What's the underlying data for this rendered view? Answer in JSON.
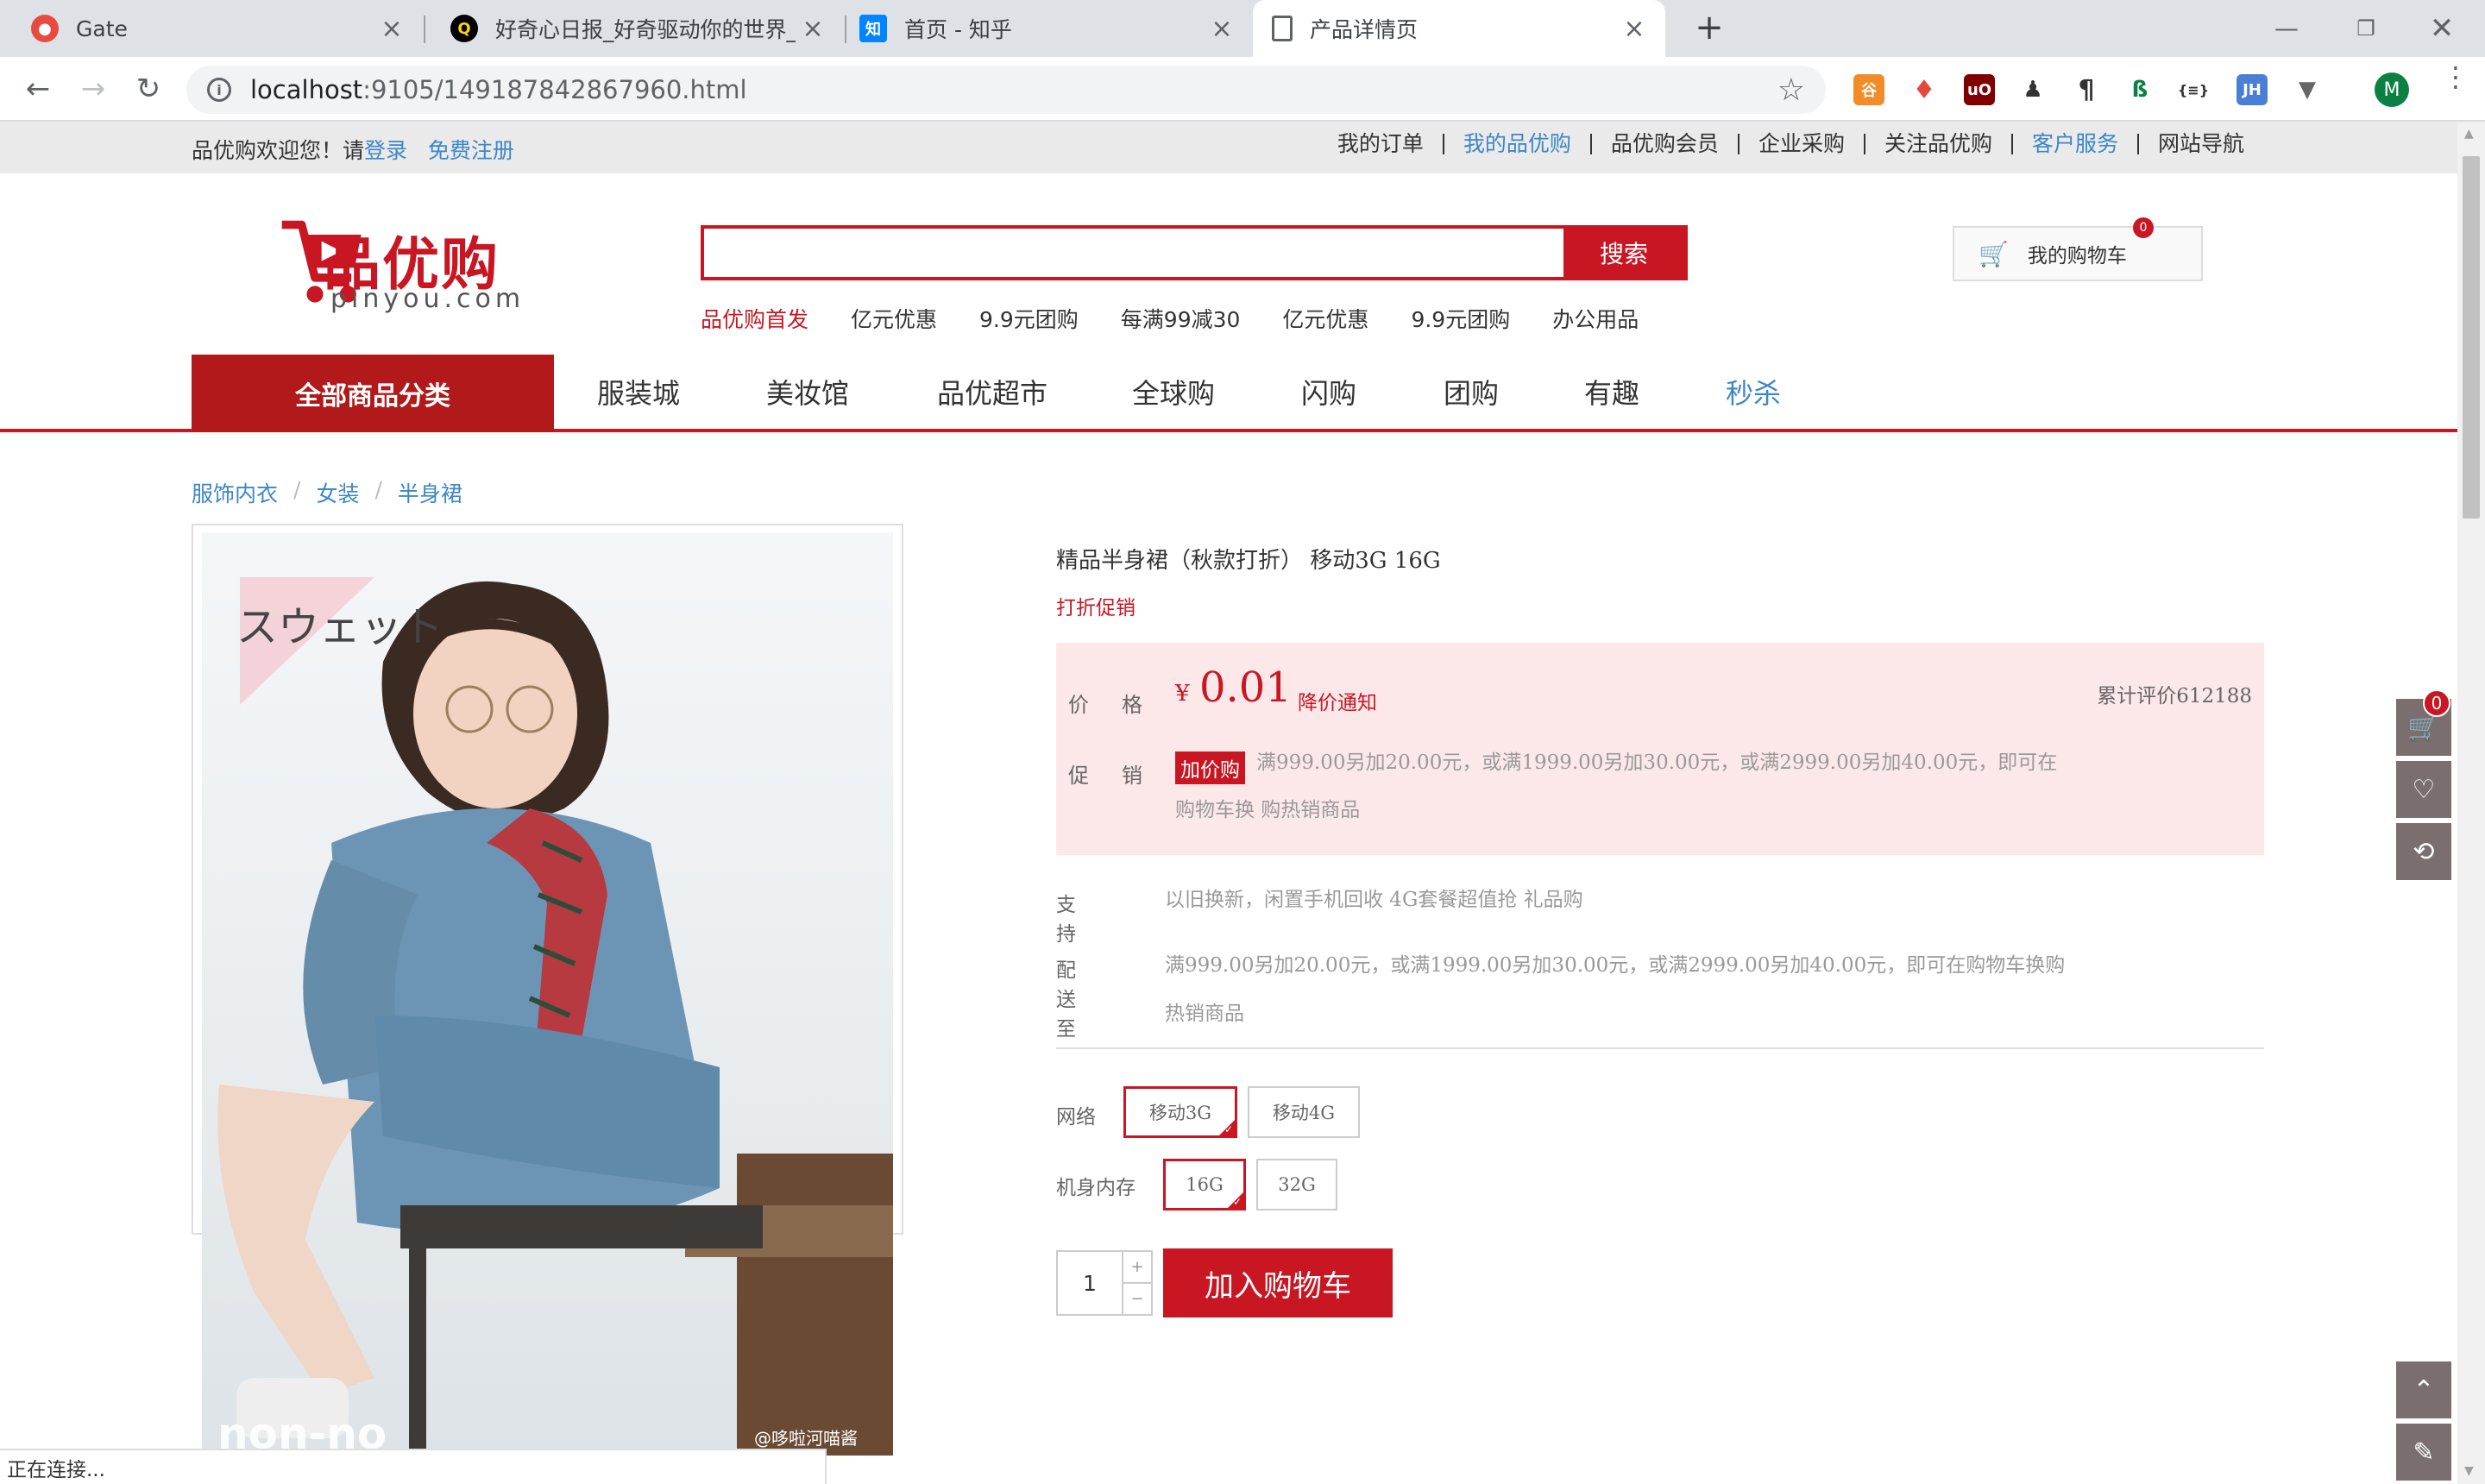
{
  "browser": {
    "tabs": [
      {
        "title": "Gate",
        "icon": "gate-favicon",
        "color": "#e94a3f"
      },
      {
        "title": "好奇心日报_好奇驱动你的世界_C",
        "icon": "qdaily-favicon",
        "color": "#000000"
      },
      {
        "title": "首页 - 知乎",
        "icon": "zhihu-favicon",
        "color": "#0084ff"
      },
      {
        "title": "产品详情页",
        "icon": "document-favicon",
        "color": "#5f6368"
      }
    ],
    "url_host": "localhost",
    "url_rest": ":9105/149187842867960.html",
    "avatar_letter": "M",
    "status_text": "正在连接..."
  },
  "site": {
    "welcome": "品优购欢迎您！请",
    "login": "登录",
    "register": "免费注册",
    "top_links": [
      {
        "label": "我的订单",
        "blue": false
      },
      {
        "label": "我的品优购",
        "blue": true
      },
      {
        "label": "品优购会员",
        "blue": false
      },
      {
        "label": "企业采购",
        "blue": false
      },
      {
        "label": "关注品优购",
        "blue": false
      },
      {
        "label": "客户服务",
        "blue": true
      },
      {
        "label": "网站导航",
        "blue": false
      }
    ],
    "logo_text": "品优购",
    "logo_sub": "pinyou.com",
    "search_button": "搜索",
    "search_placeholder": "",
    "hot_words": [
      "品优购首发",
      "亿元优惠",
      "9.9元团购",
      "每满99减30",
      "亿元优惠",
      "9.9元团购",
      "办公用品"
    ],
    "cart_label": "我的购物车",
    "cart_count": "0",
    "all_categories": "全部商品分类",
    "nav": [
      {
        "label": "服装城",
        "blue": false
      },
      {
        "label": "美妆馆",
        "blue": false
      },
      {
        "label": "品优超市",
        "blue": false
      },
      {
        "label": "全球购",
        "blue": false
      },
      {
        "label": "闪购",
        "blue": false
      },
      {
        "label": "团购",
        "blue": false
      },
      {
        "label": "有趣",
        "blue": false
      },
      {
        "label": "秒杀",
        "blue": true
      }
    ],
    "accent_color": "#c81623",
    "link_color": "#3c87c7"
  },
  "product": {
    "breadcrumb": [
      "服饰内衣",
      "女装",
      "半身裙"
    ],
    "image_overlay_text": "スウェット",
    "image_watermark": "non-no",
    "image_credit": "@哆啦河喵酱",
    "title": "精品半身裙（秋款打折） 移动3G 16G",
    "promo_tag": "打折促销",
    "price_label": "价格",
    "price_currency": "¥",
    "price": "0.01",
    "price_notify": "降价通知",
    "review_count": "累计评价612188",
    "promotion_label": "促销",
    "promotion_badge": "加价购",
    "promotion_text": "满999.00另加20.00元，或满1999.00另加30.00元，或满2999.00另加40.00元，即可在购物车换 购热销商品",
    "support_label": "支持",
    "support_text": "以旧换新，闲置手机回收 4G套餐超值抢 礼品购",
    "delivery_label": "配送至",
    "delivery_text": "满999.00另加20.00元，或满1999.00另加30.00元，或满2999.00另加40.00元，即可在购物车换购热销商品",
    "network_label": "网络",
    "network_options": [
      {
        "label": "移动3G",
        "selected": true
      },
      {
        "label": "移动4G",
        "selected": false
      }
    ],
    "storage_label": "机身内存",
    "storage_options": [
      {
        "label": "16G",
        "selected": true
      },
      {
        "label": "32G",
        "selected": false
      }
    ],
    "quantity": "1",
    "add_to_cart": "加入购物车"
  },
  "sidebar": {
    "cart_badge": "0"
  }
}
